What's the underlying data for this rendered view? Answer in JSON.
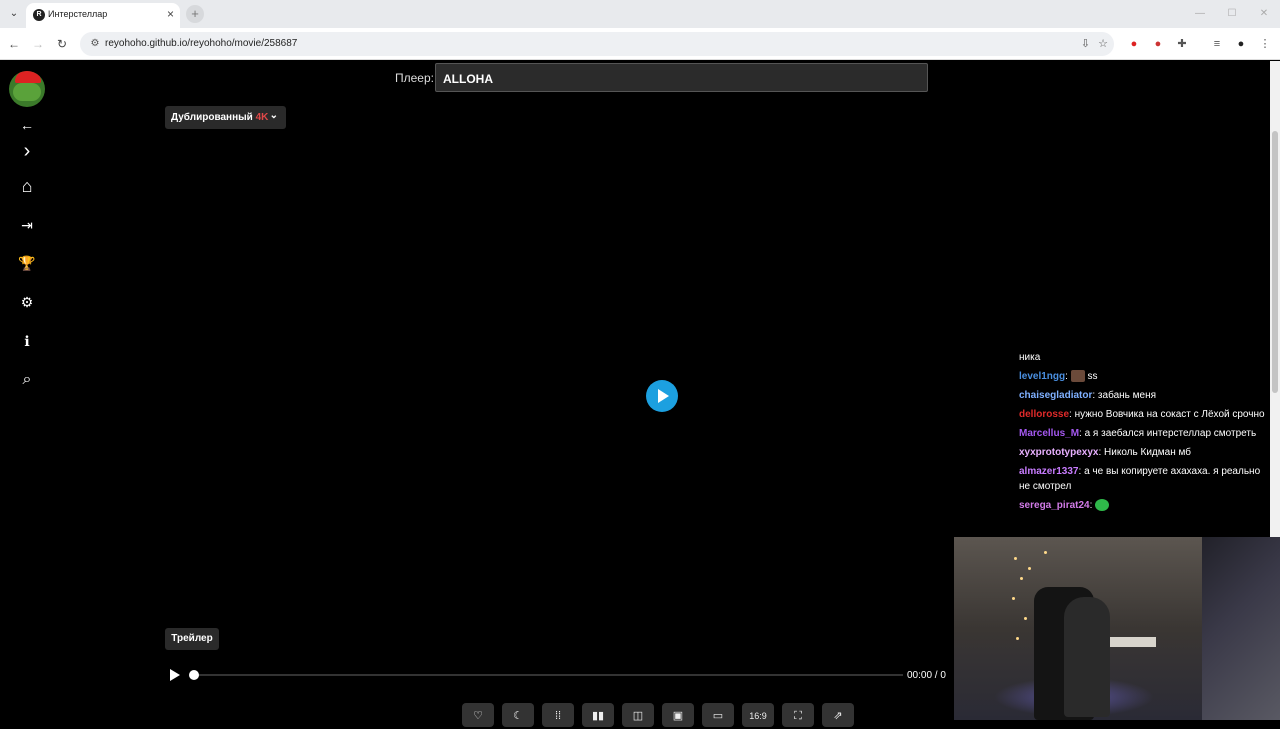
{
  "browser": {
    "tab_title": "Интерстеллар",
    "tab_favicon_letter": "R",
    "new_tab_symbol": "+",
    "url": "reyohoho.github.io/reyohoho/movie/258687",
    "window_controls": [
      "—",
      "☐",
      "✕"
    ]
  },
  "sidebar": {
    "items": [
      {
        "icon": "back-arrow-icon",
        "glyph": "←"
      },
      {
        "icon": "forward-chevron-icon",
        "glyph": "›"
      },
      {
        "icon": "home-icon",
        "glyph": "⌂"
      },
      {
        "icon": "login-icon",
        "glyph": "⇥"
      },
      {
        "icon": "trophy-icon",
        "glyph": "🏆"
      },
      {
        "icon": "gear-icon",
        "glyph": "⚙"
      },
      {
        "icon": "info-icon",
        "glyph": "ℹ"
      },
      {
        "icon": "search-icon",
        "glyph": "⌕"
      }
    ]
  },
  "player": {
    "label": "Плеер:",
    "selected": "ALLOHA",
    "dub_label": "Дублированный",
    "dub_quality": "4K",
    "trailer_label": "Трейлер",
    "time": "00:00 / 0",
    "progress": 0,
    "toolbar": [
      {
        "icon": "heart-icon",
        "glyph": "♡"
      },
      {
        "icon": "moon-icon",
        "glyph": "☾"
      },
      {
        "icon": "grid-icon",
        "glyph": "⁞⁞"
      },
      {
        "icon": "equalizer-icon",
        "glyph": "▮▮"
      },
      {
        "icon": "compare-icon",
        "glyph": "◫"
      },
      {
        "icon": "picture-icon",
        "glyph": "▣"
      },
      {
        "icon": "pip-icon",
        "glyph": "▭"
      },
      {
        "icon": "aspect-ratio-icon",
        "glyph": "16:9"
      },
      {
        "icon": "screenshot-icon",
        "glyph": "⛶"
      },
      {
        "icon": "external-icon",
        "glyph": "⇗"
      }
    ]
  },
  "chat": {
    "messages": [
      {
        "name": "",
        "name_color": "#ffffff",
        "text": "ника"
      },
      {
        "name": "level1ngg",
        "name_color": "#4a90e2",
        "text": "ss"
      },
      {
        "name": "chaisegladiator",
        "name_color": "#7fb0ff",
        "text": "забань меня"
      },
      {
        "name": "dellorosse",
        "name_color": "#e02a2a",
        "text": "нужно Вовчика на сокаст с Лёхой срочно"
      },
      {
        "name": "Marcellus_M",
        "name_color": "#a458f0",
        "text": "а я заебался интерстеллар смотреть"
      },
      {
        "name": "xyxprototypexyx",
        "name_color": "#e8b0ff",
        "text": "Николь Кидман мб"
      },
      {
        "name": "almazer1337",
        "name_color": "#c87cff",
        "text": "а че вы копируете ахахаха. я реально не смотрел"
      },
      {
        "name": "serega_pirat24",
        "name_color": "#d27be8",
        "text": ""
      }
    ]
  },
  "colors": {
    "accent_play": "#1ca0e0",
    "quality_red": "#e04848"
  }
}
